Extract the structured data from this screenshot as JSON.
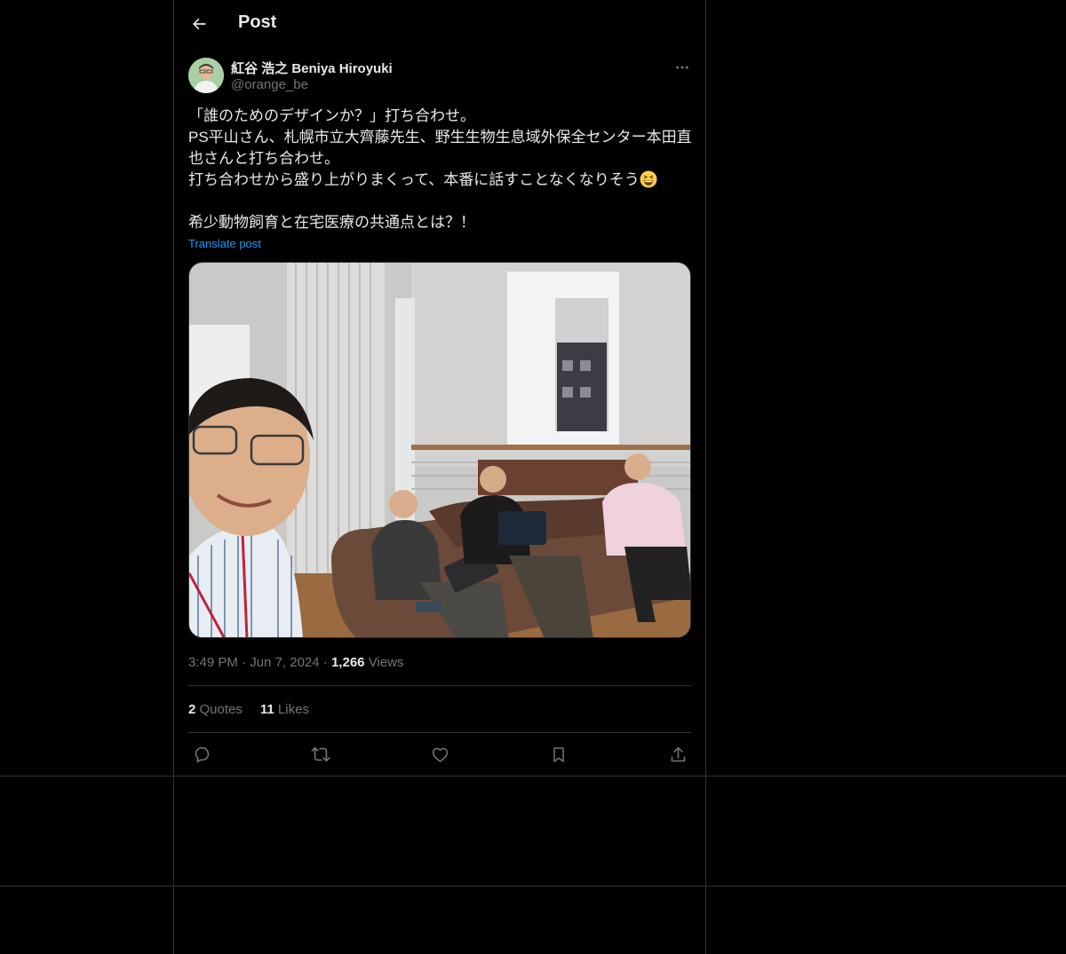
{
  "header": {
    "title": "Post"
  },
  "author": {
    "name": "紅谷 浩之 Beniya Hiroyuki",
    "handle": "@orange_be"
  },
  "post": {
    "text": "「誰のためのデザインか？」打ち合わせ。\nPS平山さん、札幌市立大齊藤先生、野生生物生息域外保全センター本田直也さんと打ち合わせ。\n打ち合わせから盛り上がりまくって、本番に話すことなくなりそう",
    "text_after_emoji": "\n\n希少動物飼育と在宅医療の共通点とは？！",
    "translate_label": "Translate post"
  },
  "meta": {
    "time": "3:49 PM",
    "date": "Jun 7, 2024",
    "views_count": "1,266",
    "views_label": "Views"
  },
  "stats": {
    "quotes_count": "2",
    "quotes_label": "Quotes",
    "likes_count": "11",
    "likes_label": "Likes"
  },
  "colors": {
    "background": "#000000",
    "border": "#2f3336",
    "text": "#e7e9ea",
    "muted": "#71767b",
    "accent": "#1d9bf0"
  },
  "icons": [
    "back-arrow-icon",
    "more-icon",
    "reply-icon",
    "repost-icon",
    "like-icon",
    "bookmark-icon",
    "share-icon"
  ]
}
